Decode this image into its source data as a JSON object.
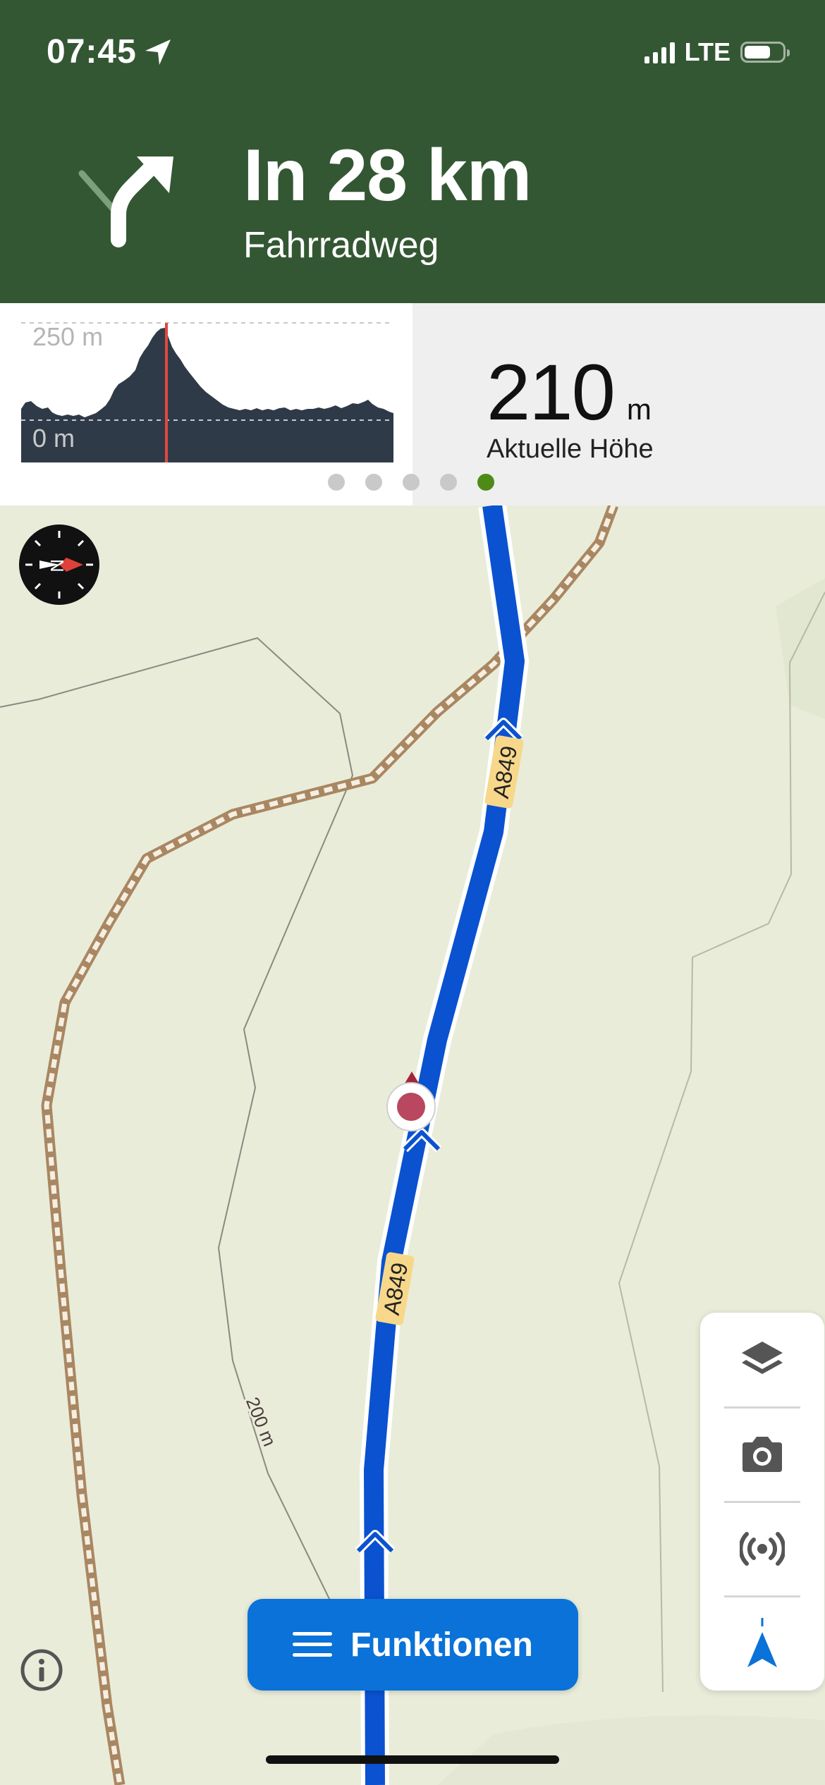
{
  "status_bar": {
    "time": "07:45",
    "network": "LTE",
    "icons": [
      "location-arrow-icon",
      "signal-bars-icon",
      "battery-icon"
    ]
  },
  "navigation": {
    "distance": "In 28 km",
    "street": "Fahrradweg",
    "maneuver_icon": "turn-slight-right-icon"
  },
  "elevation_chart": {
    "label_top": "250 m",
    "label_bottom": "0 m",
    "colors": {
      "area": "#2f3a48",
      "marker": "#e0483f"
    }
  },
  "altitude": {
    "value": "210",
    "unit": "m",
    "label": "Aktuelle Höhe"
  },
  "pager": {
    "count": 5,
    "active_index": 4
  },
  "map": {
    "road_labels": [
      "A849",
      "A849"
    ],
    "contour_label": "200 m",
    "route_color": "#0a52cf"
  },
  "controls": {
    "functions_label": "Funktionen",
    "tool_icons": [
      "layers-icon",
      "camera-icon",
      "live-tracking-icon",
      "navigation-arrow-icon"
    ]
  }
}
